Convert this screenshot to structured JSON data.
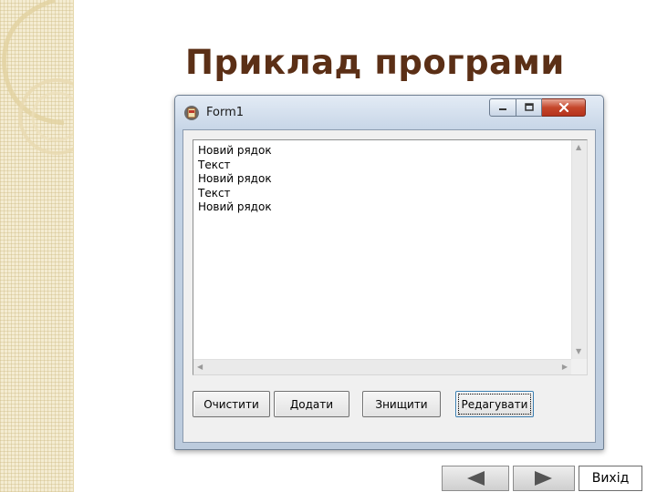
{
  "slide": {
    "title": "Приклад програми"
  },
  "window": {
    "title": "Form1",
    "icon": "app-icon",
    "controls": [
      "minimize-icon",
      "maximize-icon",
      "close-icon"
    ],
    "memo": {
      "lines": [
        "Новий рядок",
        "Текст",
        "Новий рядок",
        "Текст",
        "Новий рядок"
      ]
    },
    "buttons": {
      "clear": "Очистити",
      "add": "Додати",
      "destroy": "Знищити",
      "edit": "Редагувати"
    }
  },
  "navigation": {
    "prev_icon": "triangle-left-icon",
    "next_icon": "triangle-right-icon",
    "exit_label": "Вихід"
  },
  "colors": {
    "title": "#5b2f16",
    "decor": "#f4ecd2",
    "close_button": "#c5462b"
  }
}
